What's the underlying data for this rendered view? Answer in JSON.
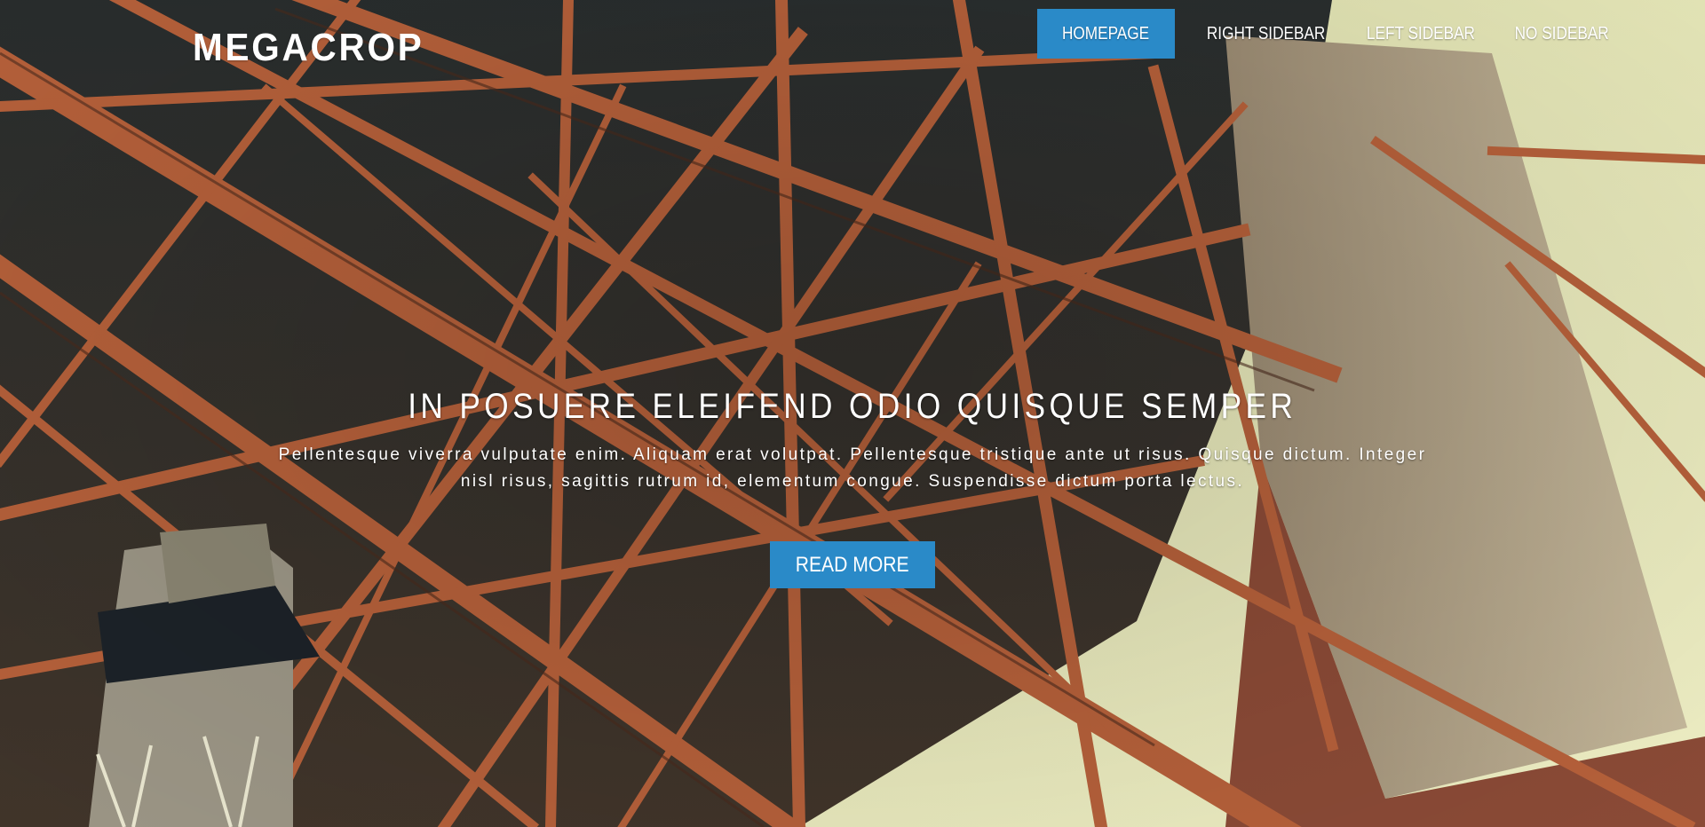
{
  "header": {
    "brand": "MEGACROP",
    "nav": [
      {
        "label": "HOMEPAGE",
        "active": true
      },
      {
        "label": "RIGHT SIDEBAR",
        "active": false
      },
      {
        "label": "LEFT SIDEBAR",
        "active": false
      },
      {
        "label": "NO SIDEBAR",
        "active": false
      }
    ]
  },
  "hero": {
    "background_image": "bridge-steel-truss-photo",
    "title": "IN POSUERE ELEIFEND ODIO QUISQUE SEMPER",
    "description": "Pellentesque viverra vulputate enim. Aliquam erat volutpat. Pellentesque tristique ante ut risus. Quisque dictum. Integer nisl risus, sagittis rutrum id, elementum congue. Suspendisse dictum porta lectus.",
    "cta_label": "READ MORE"
  },
  "colors": {
    "accent": "#2a8ac8",
    "text": "#ffffff",
    "girder": "#b5603a",
    "sky": "#e8e7bd"
  }
}
